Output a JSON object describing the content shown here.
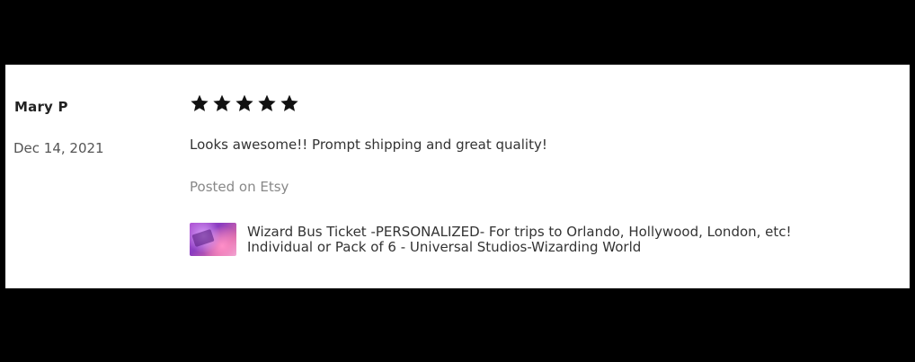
{
  "review": {
    "reviewer_name": "Mary P",
    "date": "Dec 14, 2021",
    "rating": 5,
    "rating_max": 5,
    "text": "Looks awesome!! Prompt shipping and great quality!",
    "posted_on": "Posted on Etsy"
  },
  "listing": {
    "title_line1": "Wizard Bus Ticket -PERSONALIZED- For trips to Orlando, Hollywood, London, etc!",
    "title_line2": "Individual or Pack of 6 - Universal Studios-Wizarding World"
  },
  "colors": {
    "background": "#000000",
    "card": "#ffffff",
    "star": "#111111"
  },
  "icons": {
    "star": "star-icon",
    "thumbnail": "listing-thumbnail-image"
  }
}
